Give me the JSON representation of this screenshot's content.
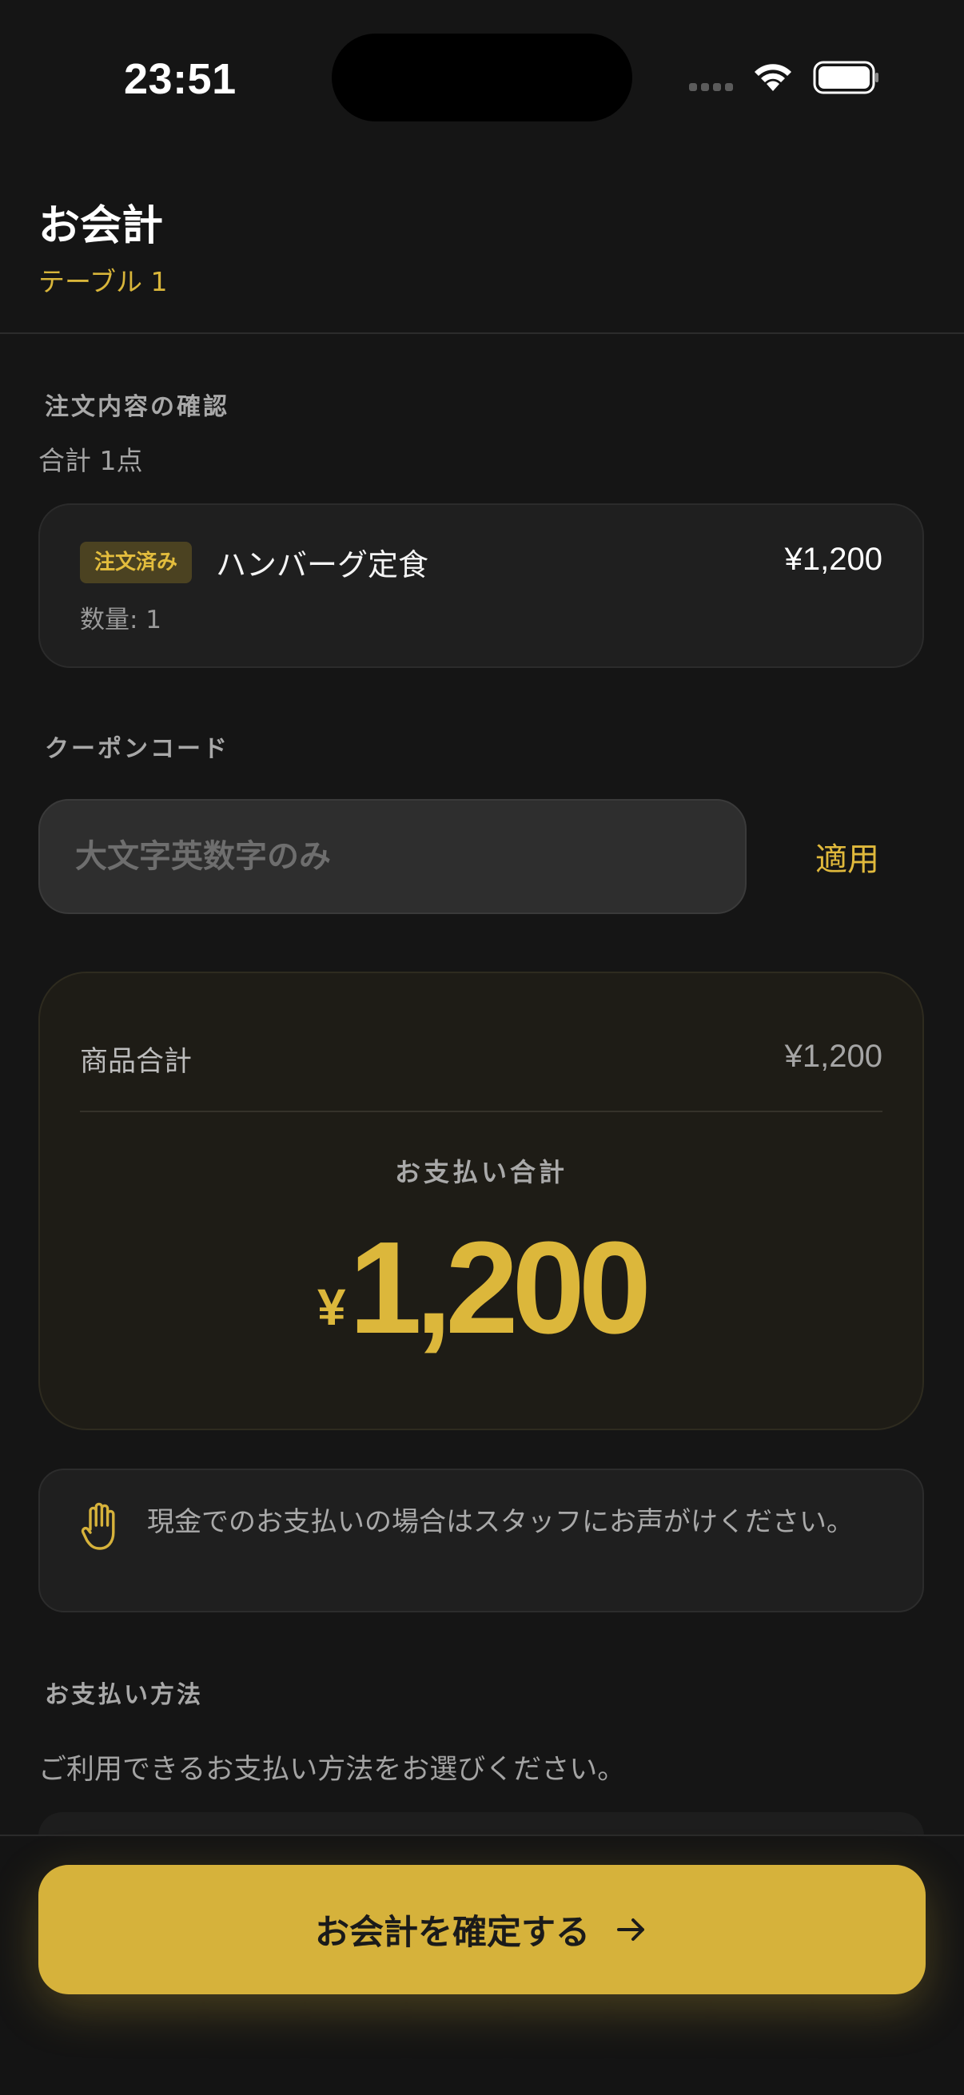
{
  "status_bar": {
    "time": "23:51"
  },
  "header": {
    "title": "お会計",
    "table_label": "テーブル 1"
  },
  "order_section": {
    "label": "注文内容の確認",
    "count_text": "合計 1点",
    "items": [
      {
        "badge": "注文済み",
        "name": "ハンバーグ定食",
        "price": "¥1,200",
        "quantity_text": "数量: 1"
      }
    ]
  },
  "coupon_section": {
    "label": "クーポンコード",
    "input_value": "",
    "placeholder": "大文字英数字のみ",
    "apply_label": "適用"
  },
  "summary": {
    "subtotal_label": "商品合計",
    "subtotal_value": "¥1,200",
    "total_label": "お支払い合計",
    "total_currency": "¥",
    "total_amount": "1,200"
  },
  "notice": {
    "text": "現金でのお支払いの場合はスタッフにお声がけください。"
  },
  "payment_section": {
    "label": "お支払い方法",
    "description": "ご利用できるお支払い方法をお選びください。"
  },
  "footer": {
    "confirm_label": "お会計を確定する"
  },
  "colors": {
    "accent": "#d6b23b",
    "background": "#151515",
    "card": "#1f1f1f"
  },
  "icons": {
    "wifi": "wifi-icon",
    "battery": "battery-icon",
    "hand": "hand-icon",
    "arrow": "arrow-right-icon"
  }
}
